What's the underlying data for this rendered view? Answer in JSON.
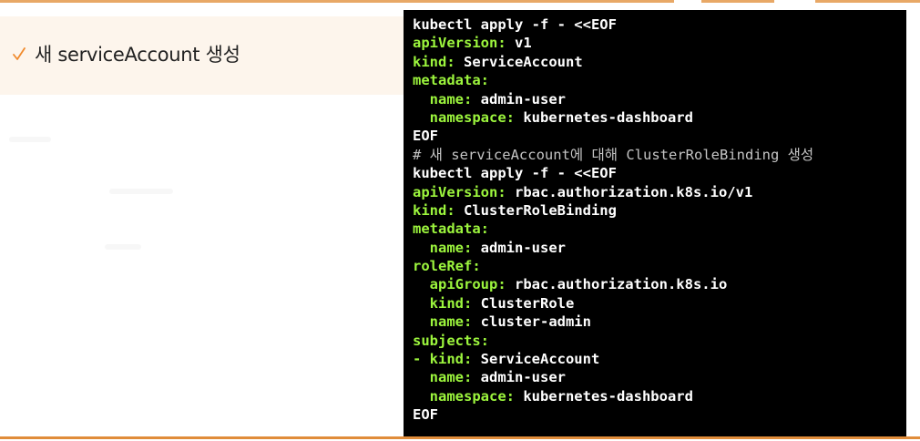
{
  "colors": {
    "accent_top": "#e8a866",
    "accent_bottom": "#e08c3a",
    "heading_band": "#fdf5ec",
    "check": "#f08a2c",
    "terminal_bg": "#000000",
    "yaml_key": "#9cf53d",
    "comment": "#c4c4c4"
  },
  "heading": {
    "icon": "check-mark-icon",
    "text": "새 serviceAccount 생성"
  },
  "terminal": {
    "lines": [
      {
        "type": "plain",
        "text": "kubectl apply -f - <<EOF"
      },
      {
        "type": "kv",
        "key": "apiVersion:",
        "value": " v1"
      },
      {
        "type": "kv",
        "key": "kind:",
        "value": " ServiceAccount"
      },
      {
        "type": "kv",
        "key": "metadata:",
        "value": ""
      },
      {
        "type": "kv",
        "key": "  name:",
        "value": " admin-user"
      },
      {
        "type": "kv",
        "key": "  namespace:",
        "value": " kubernetes-dashboard"
      },
      {
        "type": "plain",
        "text": "EOF"
      },
      {
        "type": "comment",
        "text": "# 새 serviceAccount에 대해 ClusterRoleBinding 생성"
      },
      {
        "type": "plain",
        "text": "kubectl apply -f - <<EOF"
      },
      {
        "type": "kv",
        "key": "apiVersion:",
        "value": " rbac.authorization.k8s.io/v1"
      },
      {
        "type": "kv",
        "key": "kind:",
        "value": " ClusterRoleBinding"
      },
      {
        "type": "kv",
        "key": "metadata:",
        "value": ""
      },
      {
        "type": "kv",
        "key": "  name:",
        "value": " admin-user"
      },
      {
        "type": "kv",
        "key": "roleRef:",
        "value": ""
      },
      {
        "type": "kv",
        "key": "  apiGroup:",
        "value": " rbac.authorization.k8s.io"
      },
      {
        "type": "kv",
        "key": "  kind:",
        "value": " ClusterRole"
      },
      {
        "type": "kv",
        "key": "  name:",
        "value": " cluster-admin"
      },
      {
        "type": "kv",
        "key": "subjects:",
        "value": ""
      },
      {
        "type": "kv",
        "key": "- kind:",
        "value": " ServiceAccount"
      },
      {
        "type": "kv",
        "key": "  name:",
        "value": " admin-user"
      },
      {
        "type": "kv",
        "key": "  namespace:",
        "value": " kubernetes-dashboard"
      },
      {
        "type": "plain",
        "text": "EOF"
      }
    ]
  }
}
